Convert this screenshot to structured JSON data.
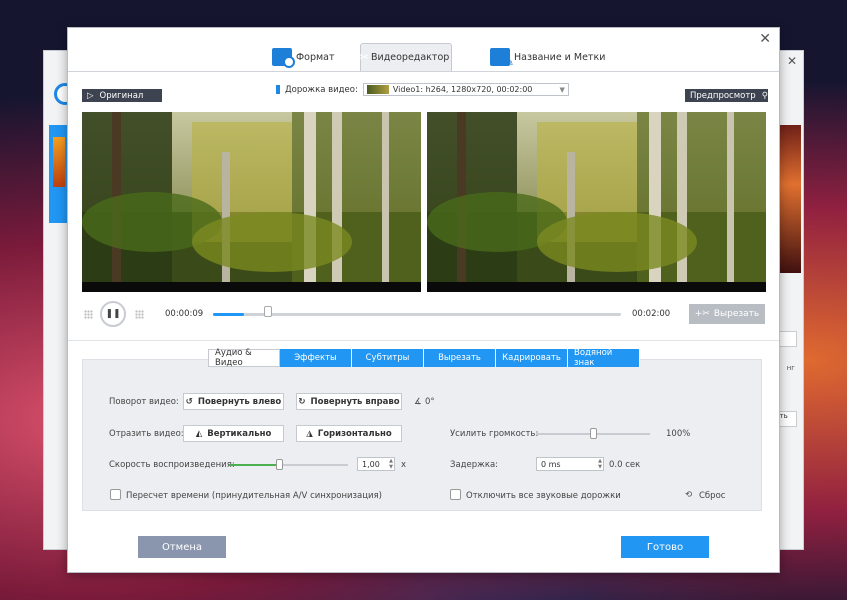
{
  "dialog": {
    "tabs": [
      {
        "label": "Формат"
      },
      {
        "label": "Видеоредактор"
      },
      {
        "label": "Название и Метки"
      }
    ]
  },
  "original": {
    "label": "Оригинал"
  },
  "preview": {
    "label": "Предпросмотр"
  },
  "track": {
    "label": "Дорожка видео:",
    "selected": "Video1: h264, 1280x720, 00:02:00"
  },
  "playback": {
    "current_time": "00:00:09",
    "total_time": "00:02:00",
    "progress": 0.075,
    "cut_label": "Вырезать"
  },
  "subtabs": [
    "Аудио & Видео",
    "Эффекты",
    "Субтитры",
    "Вырезать",
    "Кадрировать",
    "Водяной знак"
  ],
  "settings": {
    "rotate_label": "Поворот видео:",
    "rotate_left": "Повернуть влево",
    "rotate_right": "Повернуть вправо",
    "rotate_angle": "0°",
    "flip_label": "Отразить видео:",
    "flip_vertical": "Вертикально",
    "flip_horizontal": "Горизонтально",
    "speed_label": "Скорость воспроизведения:",
    "speed_value": "1,00",
    "speed_unit": "x",
    "speed_level": 0.42,
    "volume_label": "Усилить громкость:",
    "volume_value": "100%",
    "volume_level": 0.5,
    "delay_label": "Задержка:",
    "delay_value": "0 ms",
    "delay_sec": "0.0 сек",
    "recalc_label": "Пересчет времени (принудительная A/V синхронизация)",
    "mute_label": "Отключить все звуковые дорожки",
    "reset_label": "Сброс"
  },
  "footer": {
    "cancel": "Отмена",
    "ok": "Готово"
  },
  "background": {
    "right_text_1": "нг",
    "right_text_2": "ыть"
  },
  "colors": {
    "accent": "#2196f3",
    "cancel": "#8a96ad"
  }
}
